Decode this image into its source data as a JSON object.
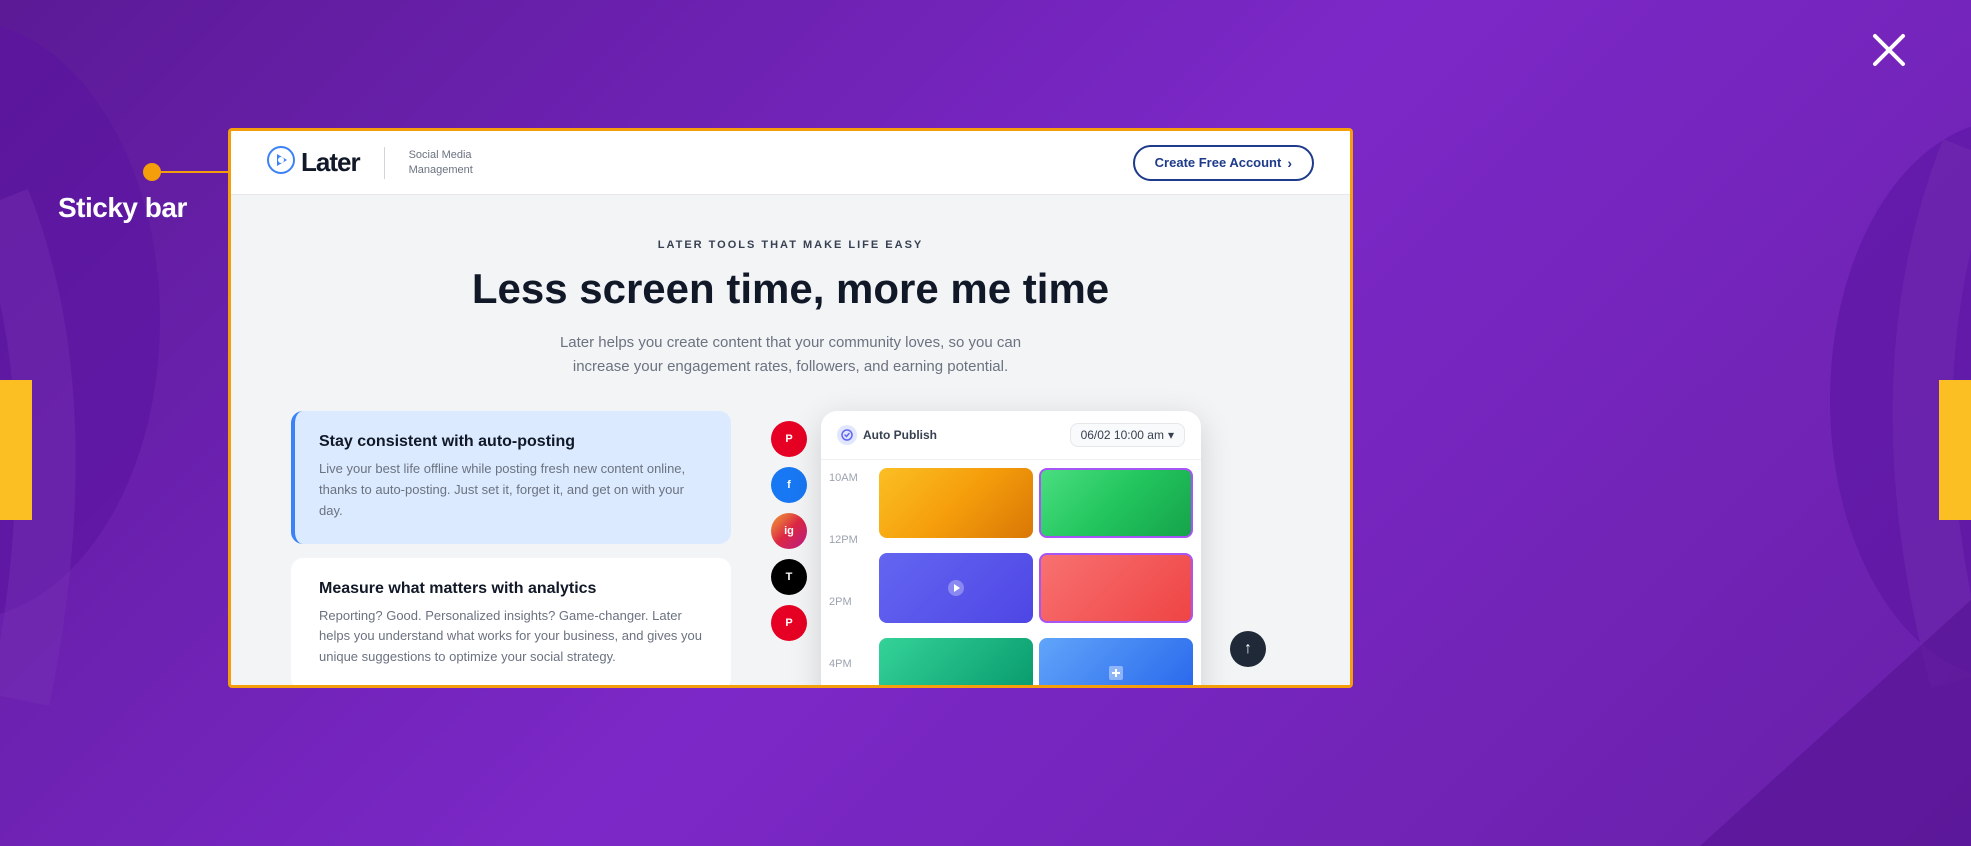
{
  "background": {
    "color": "#6b21a8"
  },
  "annotation": {
    "label": "Sticky bar",
    "dot_color": "#f59e0b"
  },
  "x_icon": "✕",
  "navbar": {
    "logo_arrow": "◈",
    "logo_text": "Later",
    "logo_subtitle_line1": "Social Media",
    "logo_subtitle_line2": "Management",
    "cta_label": "Create Free Account",
    "cta_chevron": "›"
  },
  "hero": {
    "eyebrow": "LATER TOOLS THAT MAKE LIFE EASY",
    "title": "Less screen time, more me time",
    "subtitle": "Later helps you create content that your community loves, so you can increase your engagement rates, followers, and earning potential."
  },
  "features": [
    {
      "id": "auto-posting",
      "active": true,
      "title": "Stay consistent with auto-posting",
      "description": "Live your best life offline while posting fresh new content online, thanks to auto-posting. Just set it, forget it, and get on with your day."
    },
    {
      "id": "analytics",
      "active": false,
      "title": "Measure what matters with analytics",
      "description": "Reporting? Good. Personalized insights? Game-changer. Later helps you understand what works for your business, and gives you unique suggestions to optimize your social strategy."
    }
  ],
  "scheduler": {
    "auto_publish_label": "Auto Publish",
    "date_label": "06/02  10:00 am",
    "date_chevron": "▾",
    "time_slots": [
      "10AM",
      "12PM",
      "2PM",
      "4PM"
    ]
  },
  "social_icons": [
    {
      "letter": "P",
      "platform": "pinterest"
    },
    {
      "letter": "f",
      "platform": "facebook"
    },
    {
      "letter": "ig",
      "platform": "instagram"
    },
    {
      "letter": "T",
      "platform": "tiktok"
    },
    {
      "letter": "P",
      "platform": "pinterest2"
    }
  ],
  "scroll_up": "↑"
}
